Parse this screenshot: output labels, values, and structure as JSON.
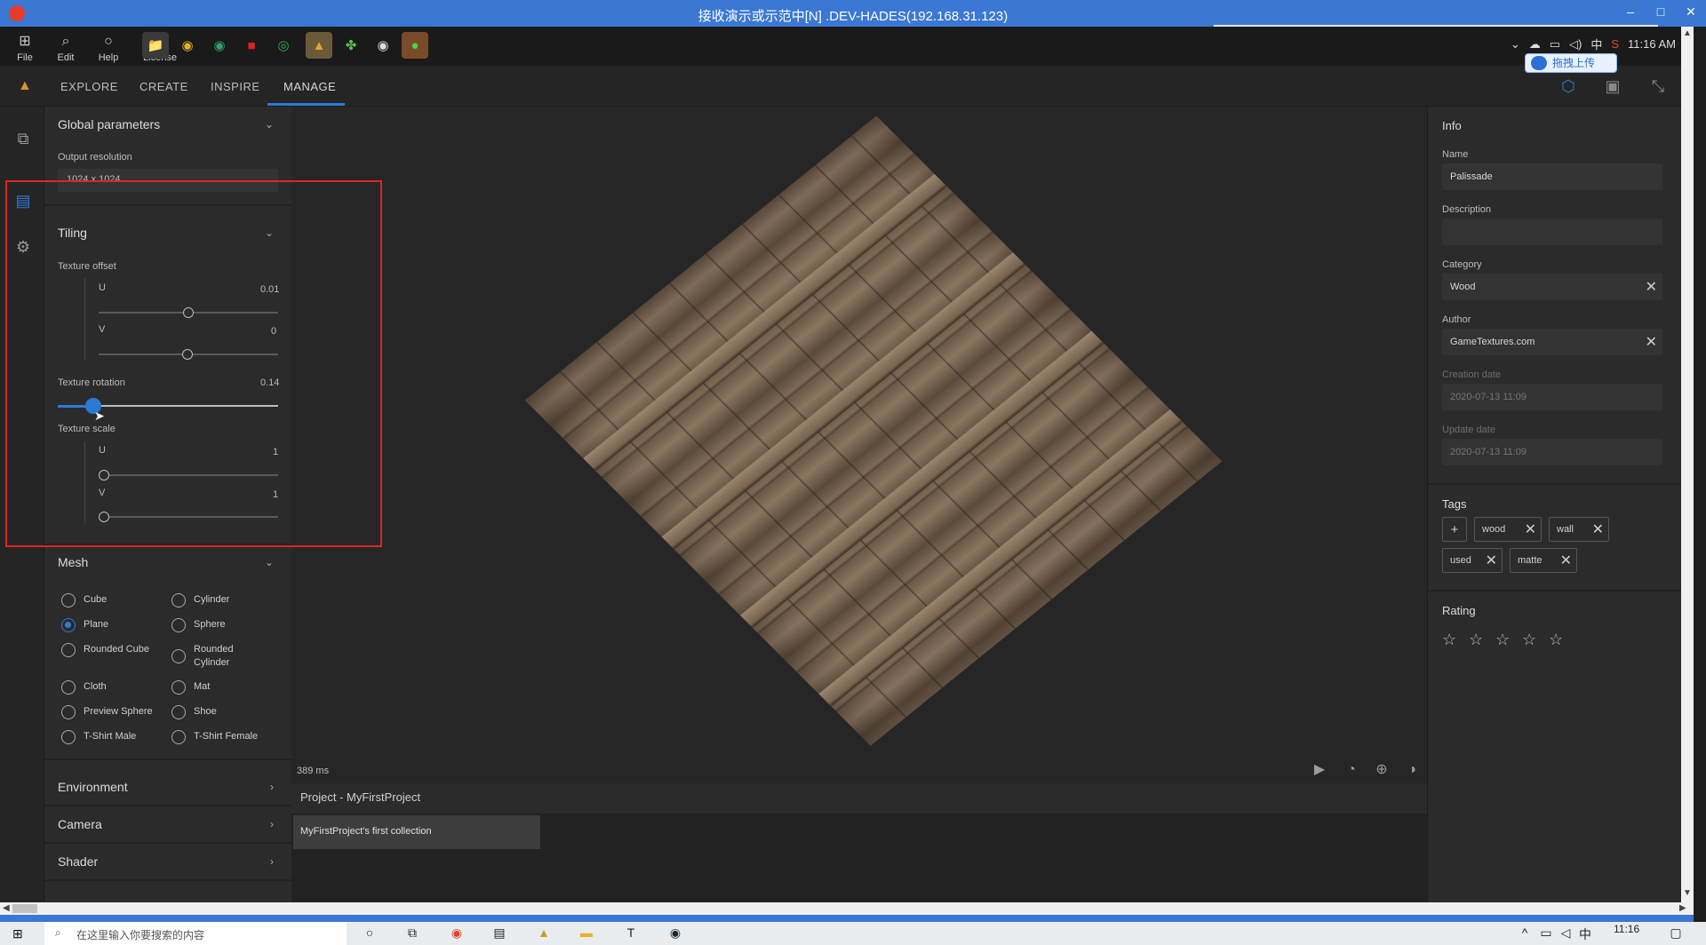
{
  "remote_window": {
    "title": "接收演示或示范中[N] .DEV-HADES(192.168.31.123)",
    "controls": [
      "–",
      "□",
      "✕"
    ]
  },
  "remote_toolbar": {
    "items": [
      {
        "label": "File",
        "icon": "windows-icon"
      },
      {
        "label": "Edit",
        "icon": "search-icon"
      },
      {
        "label": "Help",
        "icon": "cortana-icon"
      },
      {
        "label": "License",
        "icon": "edge-icon"
      }
    ],
    "tray": {
      "time": "11:16 AM",
      "ime": "中"
    }
  },
  "cloud_upload": {
    "label": "拖拽上传"
  },
  "nav": {
    "tabs": [
      "EXPLORE",
      "CREATE",
      "INSPIRE",
      "MANAGE"
    ],
    "active_tab": "MANAGE"
  },
  "left_panel": {
    "global": {
      "title": "Global parameters",
      "output_resolution_label": "Output resolution",
      "output_resolution_value": "1024 x 1024"
    },
    "tiling": {
      "title": "Tiling",
      "texture_offset_label": "Texture offset",
      "offset_u_label": "U",
      "offset_u_value": "0.01",
      "offset_v_label": "V",
      "offset_v_value": "0",
      "rotation_label": "Texture rotation",
      "rotation_value": "0.14",
      "scale_label": "Texture scale",
      "scale_u_label": "U",
      "scale_u_value": "1",
      "scale_v_label": "V",
      "scale_v_value": "1"
    },
    "mesh": {
      "title": "Mesh",
      "options": [
        "Cube",
        "Cylinder",
        "Plane",
        "Sphere",
        "Rounded Cube",
        "Rounded Cylinder",
        "Cloth",
        "Mat",
        "Preview Sphere",
        "Shoe",
        "T-Shirt Male",
        "T-Shirt Female"
      ],
      "selected": "Plane"
    },
    "environment": {
      "title": "Environment"
    },
    "camera": {
      "title": "Camera"
    },
    "shader": {
      "title": "Shader"
    }
  },
  "viewport": {
    "render_time": "389 ms"
  },
  "project": {
    "title": "Project - MyFirstProject",
    "collection": "MyFirstProject's first collection"
  },
  "info": {
    "title": "Info",
    "name_label": "Name",
    "name_value": "Palissade",
    "description_label": "Description",
    "description_value": "",
    "category_label": "Category",
    "category_value": "Wood",
    "author_label": "Author",
    "author_value": "GameTextures.com",
    "creation_label": "Creation date",
    "creation_value": "2020-07-13 11:09",
    "update_label": "Update date",
    "update_value": "2020-07-13 11:09"
  },
  "tags": {
    "title": "Tags",
    "add": "+",
    "items": [
      "wood",
      "wall",
      "used",
      "matte"
    ]
  },
  "rating": {
    "title": "Rating",
    "value": 0,
    "max": 5
  },
  "taskbar": {
    "search_placeholder": "在这里输入你要搜索的内容",
    "clock": "11:16"
  }
}
